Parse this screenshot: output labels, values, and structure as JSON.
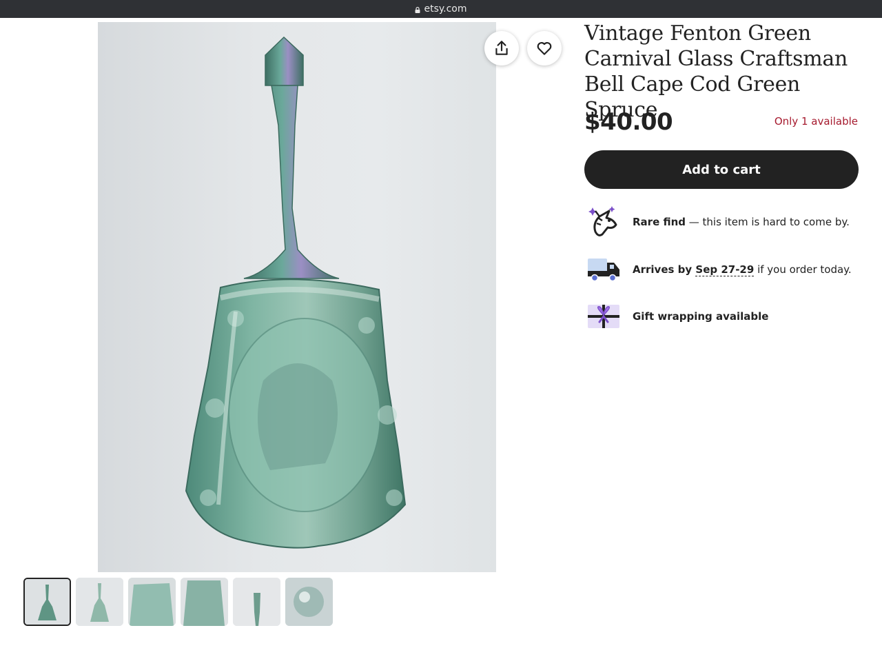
{
  "browser": {
    "url": "etsy.com"
  },
  "listing": {
    "title": "Vintage Fenton Green Carnival Glass Craftsman Bell Cape Cod Green Spruce",
    "price": "$40.00",
    "availability": "Only 1 available",
    "add_to_cart_label": "Add to cart",
    "highlights": {
      "rare_find": {
        "bold": "Rare find",
        "rest": " — this item is hard to come by."
      },
      "arrives": {
        "prefix": "Arrives by ",
        "date": "Sep 27-29",
        "suffix": " if you order today."
      },
      "gift": {
        "label": "Gift wrapping available"
      }
    }
  },
  "gallery": {
    "thumbnails": [
      "thumb-1",
      "thumb-2",
      "thumb-3",
      "thumb-4",
      "thumb-5",
      "thumb-6"
    ]
  },
  "icons": {
    "lock": "lock-icon",
    "share": "share-icon",
    "favorite": "heart-icon",
    "rare": "unicorn-icon",
    "shipping": "truck-icon",
    "gift": "gift-icon"
  },
  "colors": {
    "availability": "#a61a2e",
    "cart_button": "#222222",
    "accent_purple": "#7b4fc9"
  }
}
